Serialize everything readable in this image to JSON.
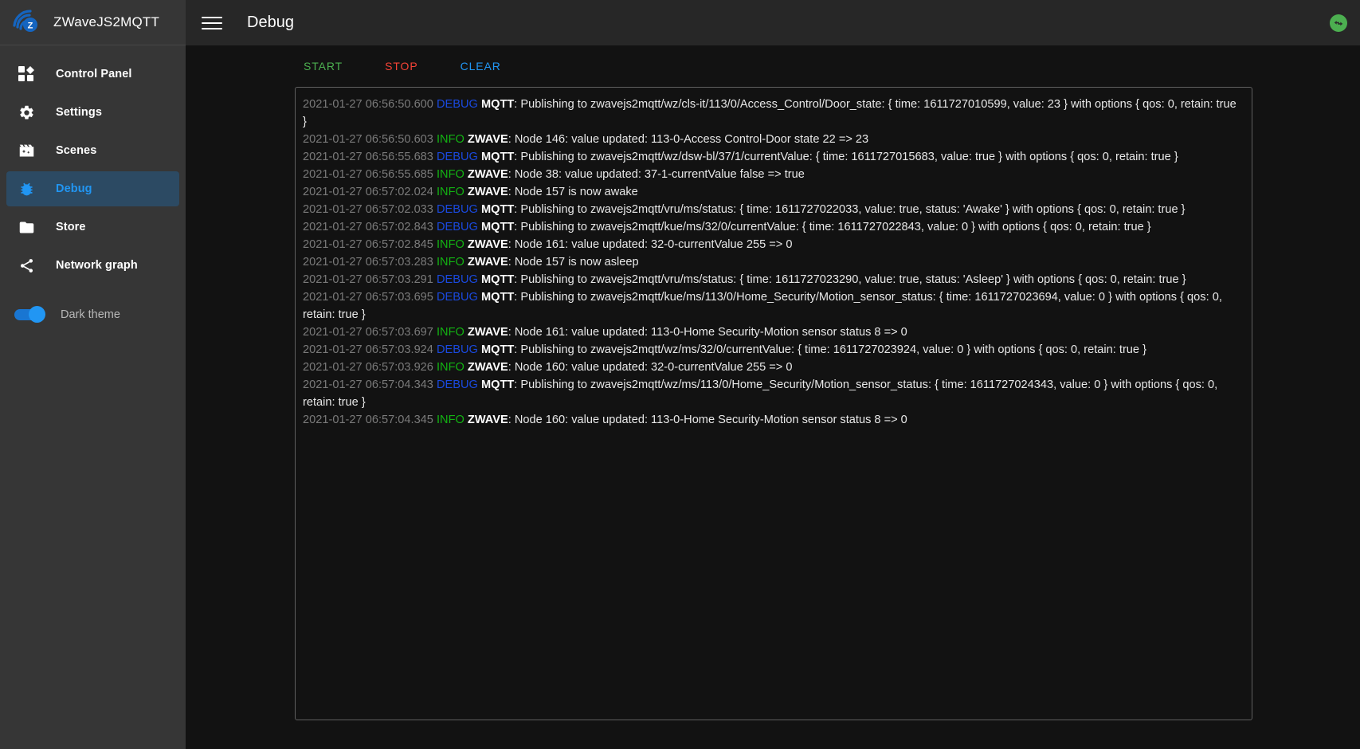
{
  "sidebar": {
    "brand": {
      "title": "ZWaveJS2MQTT",
      "logo_icon": "zwave-wifi-logo-icon"
    },
    "items": [
      {
        "label": "Control Panel",
        "icon": "dashboard-icon",
        "active": false
      },
      {
        "label": "Settings",
        "icon": "gear-icon",
        "active": false
      },
      {
        "label": "Scenes",
        "icon": "movie-clapper-icon",
        "active": false
      },
      {
        "label": "Debug",
        "icon": "bug-icon",
        "active": true
      },
      {
        "label": "Store",
        "icon": "folder-icon",
        "active": false
      },
      {
        "label": "Network graph",
        "icon": "share-nodes-icon",
        "active": false
      }
    ],
    "theme_toggle": {
      "label": "Dark theme",
      "on": true
    }
  },
  "topbar": {
    "menu_icon": "hamburger-menu-icon",
    "title": "Debug",
    "status_icon": "connection-arrows-icon",
    "status_color": "#4caf50"
  },
  "toolbar": {
    "start_label": "START",
    "stop_label": "STOP",
    "clear_label": "CLEAR",
    "start_color": "#4caf50",
    "stop_color": "#f44336",
    "clear_color": "#2196f3"
  },
  "log": {
    "lines": [
      {
        "ts": "2021-01-27 06:56:50.600",
        "level": "DEBUG",
        "module": "MQTT",
        "text": ": Publishing to zwavejs2mqtt/wz/cls-it/113/0/Access_Control/Door_state: { time: 1611727010599, value: 23 } with options { qos: 0, retain: true }"
      },
      {
        "ts": "2021-01-27 06:56:50.603",
        "level": "INFO",
        "module": "ZWAVE",
        "text": ": Node 146: value updated: 113-0-Access Control-Door state 22 => 23"
      },
      {
        "ts": "2021-01-27 06:56:55.683",
        "level": "DEBUG",
        "module": "MQTT",
        "text": ": Publishing to zwavejs2mqtt/wz/dsw-bl/37/1/currentValue: { time: 1611727015683, value: true } with options { qos: 0, retain: true }"
      },
      {
        "ts": "2021-01-27 06:56:55.685",
        "level": "INFO",
        "module": "ZWAVE",
        "text": ": Node 38: value updated: 37-1-currentValue false => true"
      },
      {
        "ts": "2021-01-27 06:57:02.024",
        "level": "INFO",
        "module": "ZWAVE",
        "text": ": Node 157 is now awake"
      },
      {
        "ts": "2021-01-27 06:57:02.033",
        "level": "DEBUG",
        "module": "MQTT",
        "text": ": Publishing to zwavejs2mqtt/vru/ms/status: { time: 1611727022033, value: true, status: 'Awake' } with options { qos: 0, retain: true }"
      },
      {
        "ts": "2021-01-27 06:57:02.843",
        "level": "DEBUG",
        "module": "MQTT",
        "text": ": Publishing to zwavejs2mqtt/kue/ms/32/0/currentValue: { time: 1611727022843, value: 0 } with options { qos: 0, retain: true }"
      },
      {
        "ts": "2021-01-27 06:57:02.845",
        "level": "INFO",
        "module": "ZWAVE",
        "text": ": Node 161: value updated: 32-0-currentValue 255 => 0"
      },
      {
        "ts": "2021-01-27 06:57:03.283",
        "level": "INFO",
        "module": "ZWAVE",
        "text": ": Node 157 is now asleep"
      },
      {
        "ts": "2021-01-27 06:57:03.291",
        "level": "DEBUG",
        "module": "MQTT",
        "text": ": Publishing to zwavejs2mqtt/vru/ms/status: { time: 1611727023290, value: true, status: 'Asleep' } with options { qos: 0, retain: true }"
      },
      {
        "ts": "2021-01-27 06:57:03.695",
        "level": "DEBUG",
        "module": "MQTT",
        "text": ": Publishing to zwavejs2mqtt/kue/ms/113/0/Home_Security/Motion_sensor_status: { time: 1611727023694, value: 0 } with options { qos: 0, retain: true }"
      },
      {
        "ts": "2021-01-27 06:57:03.697",
        "level": "INFO",
        "module": "ZWAVE",
        "text": ": Node 161: value updated: 113-0-Home Security-Motion sensor status 8 => 0"
      },
      {
        "ts": "2021-01-27 06:57:03.924",
        "level": "DEBUG",
        "module": "MQTT",
        "text": ": Publishing to zwavejs2mqtt/wz/ms/32/0/currentValue: { time: 1611727023924, value: 0 } with options { qos: 0, retain: true }"
      },
      {
        "ts": "2021-01-27 06:57:03.926",
        "level": "INFO",
        "module": "ZWAVE",
        "text": ": Node 160: value updated: 32-0-currentValue 255 => 0"
      },
      {
        "ts": "2021-01-27 06:57:04.343",
        "level": "DEBUG",
        "module": "MQTT",
        "text": ": Publishing to zwavejs2mqtt/wz/ms/113/0/Home_Security/Motion_sensor_status: { time: 1611727024343, value: 0 } with options { qos: 0, retain: true }"
      },
      {
        "ts": "2021-01-27 06:57:04.345",
        "level": "INFO",
        "module": "ZWAVE",
        "text": ": Node 160: value updated: 113-0-Home Security-Motion sensor status 8 => 0"
      }
    ]
  }
}
